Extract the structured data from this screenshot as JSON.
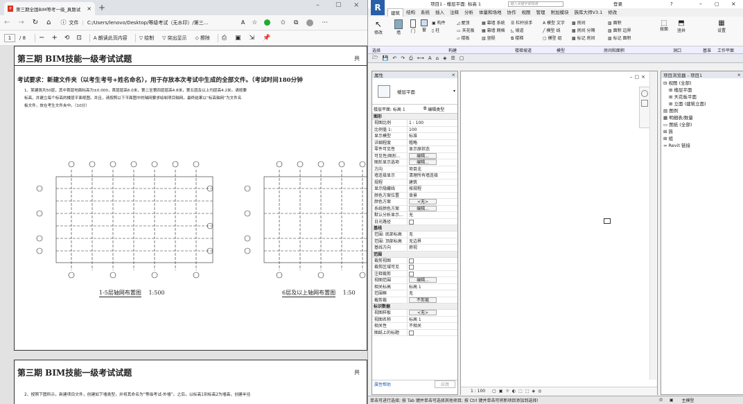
{
  "browser": {
    "tab_title": "第三期全国BIM等考一级_真题试",
    "url": "C:/Users/lenovo/Desktop/等级考试（无水印）/第三...",
    "file_label": "文件",
    "page_num": "1",
    "page_total": "/ 8",
    "read_aloud": "朗读此页内容",
    "draw": "绘制",
    "highlight": "突出显示",
    "erase": "擦除"
  },
  "pdf": {
    "page1": {
      "title": "第三期 BIM技能一级考试试题",
      "corner": "共",
      "req": "考试要求：新建文件夹（以考生考号+姓名命名），用于存放本次考试中生成的全部文件。（考试时间180分钟",
      "q1a": "1、某建筑共50层，其中首层地面标高为±0.000，首层层高6.0米，第二至第四层层高4.8米，第五层及以上均层高4.2米。请按要",
      "q1b": "标高，并建立每个标高的楼层平面视图。并且，请按照以下平面图中的轴网要求绘制项目轴网。最终结果以“标高轴网”为文件名",
      "q1c": "板文件，放在考生文件夹中。（10分）",
      "cap1": "1-5层轴网布置图",
      "scale1": "1:500",
      "cap2": "6层及以上轴网布置图",
      "scale2": "1:50"
    },
    "page2": {
      "title": "第三期 BIM技能一级考试试题",
      "corner": "共",
      "q2": "2、按照下图所示，新建项目文件，创建如下墙类型，并将其命名为“等级考试-外墙”。之后，以标高1到标高2为墙高，创建半径"
    }
  },
  "revit": {
    "title": "项目1 - 楼层平面: 标高 1",
    "search_placeholder": "键入关键字或短语",
    "login": "登录",
    "tabs": [
      "建筑",
      "结构",
      "系统",
      "插入",
      "注释",
      "分析",
      "体量和场地",
      "协作",
      "视图",
      "管理",
      "附加模块",
      "族库大师V3.1",
      "修改"
    ],
    "ribbon": {
      "modify": "修改",
      "wall": "墙",
      "door": "门",
      "window": "窗",
      "component": "构件",
      "column": "柱",
      "roof": "屋顶",
      "ceiling": "天花板",
      "floor": "楼板",
      "curtain_system": "幕墙 系统",
      "curtain_grid": "幕墙 网格",
      "mullion": "竖梃",
      "railing": "栏杆扶手",
      "ramp": "坡道",
      "stair": "楼梯",
      "model_text": "模型 文字",
      "model_line": "模型 线",
      "model_group": "模型 组",
      "room": "房间",
      "room_sep": "房间 分隔",
      "tag_room": "标记 房间",
      "area": "面积",
      "area_boundary": "面积 边界",
      "tag_area": "标记 面积",
      "by_face": "按面",
      "shaft": "竖井",
      "set": "设置",
      "groups": [
        "选择",
        "构建",
        "楼梯坡道",
        "模型",
        "房间和面积",
        "洞口",
        "基准",
        "工作平面"
      ]
    },
    "props": {
      "header": "属性",
      "type_name": "楼层平面",
      "selector": "楼层平面: 标高 1",
      "edit_type": "编辑类型",
      "help": "属性帮助",
      "apply": "应用",
      "groups": {
        "graphics": "图形",
        "underlay": "基线",
        "extents": "范围",
        "identity": "标识数据"
      },
      "rows_graphics": [
        {
          "k": "视图比例",
          "v": "1 : 100"
        },
        {
          "k": "比例值 1:",
          "v": "100"
        },
        {
          "k": "显示模型",
          "v": "标准"
        },
        {
          "k": "详细程度",
          "v": "粗略"
        },
        {
          "k": "零件可见性",
          "v": "显示原状态"
        },
        {
          "k": "可见性/图形...",
          "v": "编辑..."
        },
        {
          "k": "图形显示选项",
          "v": "编辑..."
        },
        {
          "k": "方向",
          "v": "项目北"
        },
        {
          "k": "墙连接显示",
          "v": "清理所有墙连接"
        },
        {
          "k": "规程",
          "v": "建筑"
        },
        {
          "k": "显示隐藏线",
          "v": "按规程"
        },
        {
          "k": "颜色方案位置",
          "v": "背景"
        },
        {
          "k": "颜色方案",
          "v": "<无>"
        },
        {
          "k": "系统颜色方案",
          "v": "编辑..."
        },
        {
          "k": "默认分析显示...",
          "v": "无"
        },
        {
          "k": "日光路径",
          "v": ""
        }
      ],
      "rows_underlay": [
        {
          "k": "范围: 底部标高",
          "v": "无"
        },
        {
          "k": "范围: 顶部标高",
          "v": "无边界"
        },
        {
          "k": "基线方向",
          "v": "俯视"
        }
      ],
      "rows_extents": [
        {
          "k": "裁剪视图",
          "v": ""
        },
        {
          "k": "裁剪区域可见",
          "v": ""
        },
        {
          "k": "注释裁剪",
          "v": ""
        },
        {
          "k": "视图范围",
          "v": "编辑..."
        },
        {
          "k": "相关标高",
          "v": "标高 1"
        },
        {
          "k": "范围框",
          "v": "无"
        },
        {
          "k": "截剪裁",
          "v": "不剪裁"
        }
      ],
      "rows_identity": [
        {
          "k": "视图样板",
          "v": "<无>"
        },
        {
          "k": "视图名称",
          "v": "标高 1"
        },
        {
          "k": "相关性",
          "v": "不相关"
        },
        {
          "k": "图纸上的标题",
          "v": ""
        }
      ]
    },
    "browser": {
      "header": "项目浏览器 - 项目1",
      "items": [
        "视图 (全部)",
        "楼层平面",
        "天花板平面",
        "立面 (建筑立面)",
        "图例",
        "明细表/数量",
        "图纸 (全部)",
        "族",
        "组",
        "Revit 链接"
      ]
    },
    "canvas": {
      "scale": "1 : 100"
    },
    "status": {
      "text": "单击可进行选择; 按 Tab 键并单击可选择其他项目; 按 Ctrl 键并单击可将新项目添加到选择!",
      "coord": ":0",
      "model": "主模型"
    }
  }
}
